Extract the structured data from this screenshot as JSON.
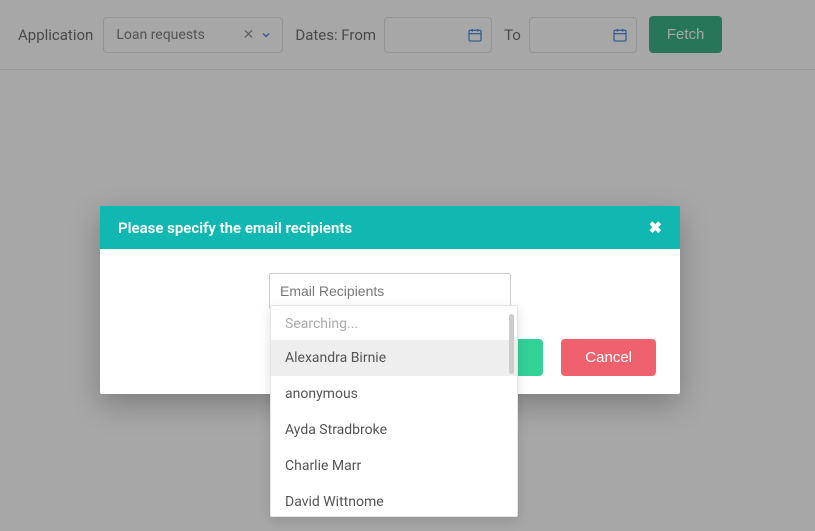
{
  "toolbar": {
    "app_label": "Application",
    "app_value": "Loan requests",
    "dates_from_label": "Dates: From",
    "dates_to_label": "To",
    "fetch_label": "Fetch"
  },
  "modal": {
    "title": "Please specify the email recipients",
    "input_placeholder": "Email Recipients",
    "cancel_label": "Cancel"
  },
  "dropdown": {
    "status": "Searching...",
    "items": [
      "Alexandra Birnie",
      "anonymous",
      "Ayda Stradbroke",
      "Charlie Marr",
      "David Wittnome"
    ],
    "highlight_index": 0
  }
}
